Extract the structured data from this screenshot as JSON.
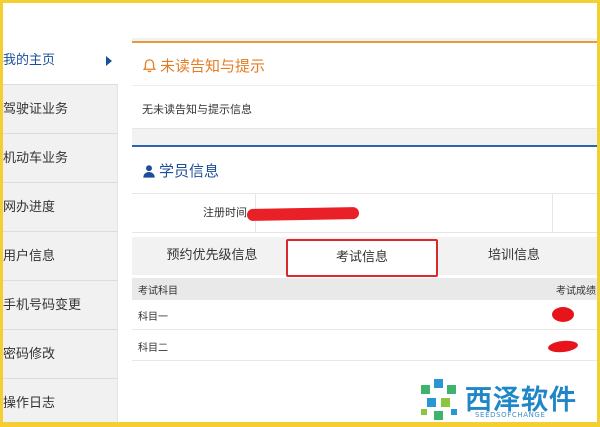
{
  "sidebar": {
    "items": [
      {
        "label": "我的主页"
      },
      {
        "label": "驾驶证业务"
      },
      {
        "label": "机动车业务"
      },
      {
        "label": "网办进度"
      },
      {
        "label": "用户信息"
      },
      {
        "label": "手机号码变更"
      },
      {
        "label": "密码修改"
      },
      {
        "label": "操作日志"
      }
    ]
  },
  "notice": {
    "title": "未读告知与提示",
    "body": "无未读告知与提示信息"
  },
  "student": {
    "title": "学员信息",
    "register_label": "注册时间"
  },
  "tabs": [
    {
      "label": "预约优先级信息"
    },
    {
      "label": "考试信息"
    },
    {
      "label": "培训信息"
    }
  ],
  "exam_table": {
    "headers": [
      "考试科目",
      "考试成绩"
    ],
    "rows": [
      {
        "subject": "科目一"
      },
      {
        "subject": "科目二"
      }
    ]
  },
  "watermark": {
    "text": "西泽软件",
    "sub": "SEEDSOFCHANGE"
  },
  "colors": {
    "frame": "#f3cf33",
    "notice_accent": "#e27d24",
    "student_accent": "#1d4e9a",
    "active_tab_border": "#d9292c",
    "redaction": "#e8141b"
  }
}
